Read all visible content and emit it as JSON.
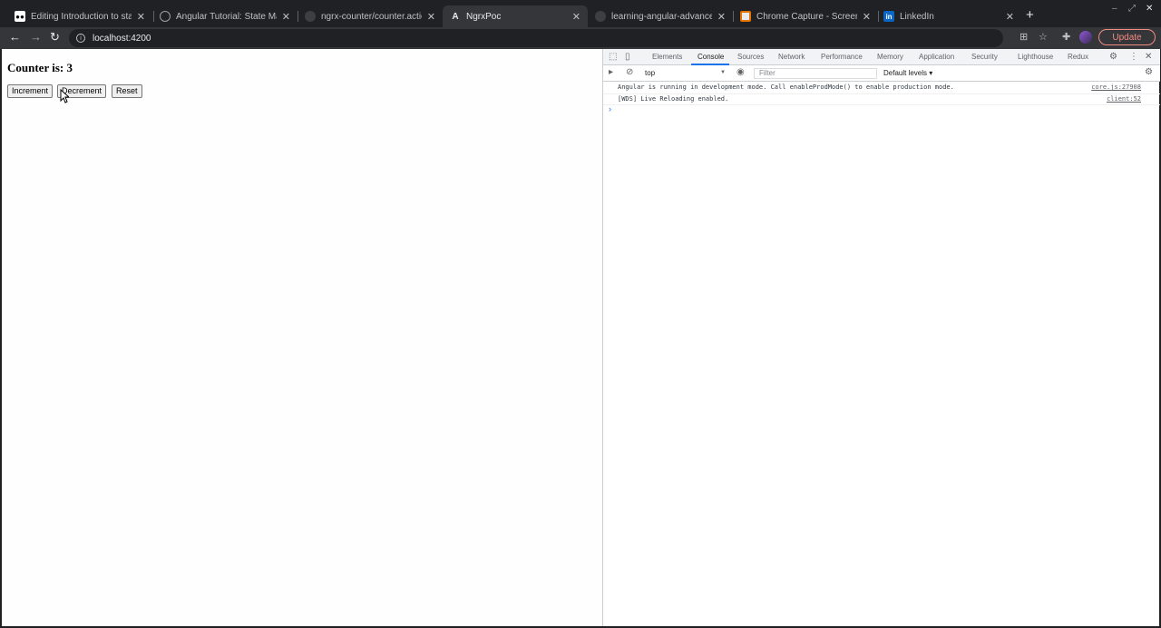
{
  "browser": {
    "tabs": [
      {
        "title": "Editing Introduction to state",
        "favicon": "medium-icon"
      },
      {
        "title": "Angular Tutorial: State Manag",
        "favicon": "globe-icon"
      },
      {
        "title": "ngrx-counter/counter.actions",
        "favicon": "github-icon"
      },
      {
        "title": "NgrxPoc",
        "favicon": "angular-icon"
      },
      {
        "title": "learning-angular-advanced/c",
        "favicon": "github-icon"
      },
      {
        "title": "Chrome Capture - Screenshot",
        "favicon": "capture-icon"
      },
      {
        "title": "LinkedIn",
        "favicon": "linkedin-icon"
      }
    ],
    "active_tab_index": 3,
    "address": "localhost:4200",
    "update_label": "Update",
    "accent": "#f28b82"
  },
  "page": {
    "counter_label": "Counter is: 3",
    "buttons": {
      "increment": "Increment",
      "decrement": "Decrement",
      "reset": "Reset"
    }
  },
  "devtools": {
    "tabs": [
      "Elements",
      "Console",
      "Sources",
      "Network",
      "Performance",
      "Memory",
      "Application",
      "Security",
      "Lighthouse",
      "Redux"
    ],
    "active_tab": "Console",
    "context": "top",
    "filter_placeholder": "Filter",
    "levels": "Default levels ▾",
    "messages": [
      {
        "text": "Angular is running in development mode. Call enableProdMode() to enable production mode.",
        "source": "core.js:27908"
      },
      {
        "text": "[WDS] Live Reloading enabled.",
        "source": "client:52"
      }
    ],
    "prompt": "›"
  }
}
